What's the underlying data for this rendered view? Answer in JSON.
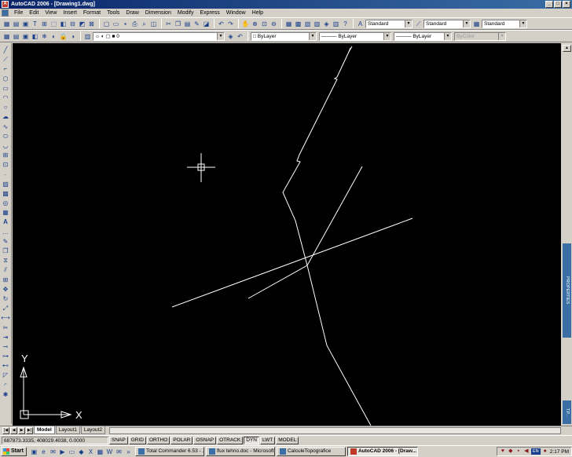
{
  "window": {
    "title": "AutoCAD 2006 - [Drawing1.dwg]",
    "app_icon": "A"
  },
  "menus": [
    "File",
    "Edit",
    "View",
    "Insert",
    "Format",
    "Tools",
    "Draw",
    "Dimension",
    "Modify",
    "Express",
    "Window",
    "Help"
  ],
  "styles_toolbar": {
    "text_style": "Standard",
    "dim_style": "Standard",
    "table_style": "Standard"
  },
  "layers_toolbar": {
    "layer": "0",
    "color": "ByLayer",
    "linetype": "ByLayer",
    "lineweight": "ByLayer",
    "plot_style": "ByColor"
  },
  "side_panel": {
    "properties_label": "PROPERTIES",
    "tool_palettes_label": "T.P..."
  },
  "ucs": {
    "y_label": "Y",
    "x_label": "X"
  },
  "layout_tabs": [
    {
      "label": "Model",
      "active": true
    },
    {
      "label": "Layout1",
      "active": false
    },
    {
      "label": "Layout2",
      "active": false
    }
  ],
  "status": {
    "coordinates": "687873.3335, 408029.4038, 0.0000",
    "toggles": [
      {
        "label": "SNAP",
        "on": false
      },
      {
        "label": "GRID",
        "on": false
      },
      {
        "label": "ORTHO",
        "on": false
      },
      {
        "label": "POLAR",
        "on": false
      },
      {
        "label": "OSNAP",
        "on": false
      },
      {
        "label": "OTRACK",
        "on": false
      },
      {
        "label": "DYN",
        "on": true
      },
      {
        "label": "LWT",
        "on": false
      },
      {
        "label": "MODEL",
        "on": false
      }
    ]
  },
  "taskbar": {
    "start_label": "Start",
    "more_label": "»",
    "tasks": [
      {
        "label": "Total Commander 6.53 - ...",
        "active": false
      },
      {
        "label": "flux tehno.doc - Microsoft...",
        "active": false
      },
      {
        "label": "CalculeTopografice",
        "active": false
      },
      {
        "label": "AutoCAD 2006 - [Draw...",
        "active": true
      }
    ],
    "tray_lang": "EN",
    "clock": "2:17 PM"
  },
  "colors": {
    "title_gradient_start": "#0a246a",
    "canvas_background": "#000000",
    "drawing_lines": "#ffffff",
    "chrome": "#d4d0c8"
  }
}
